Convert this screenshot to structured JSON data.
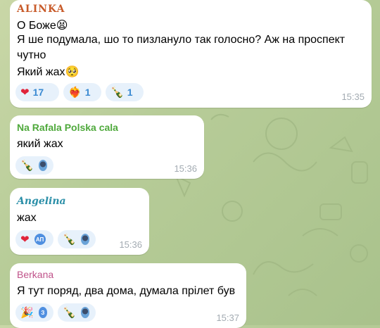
{
  "messages": [
    {
      "sender": "ALINKA",
      "sender_color": "#c85b2a",
      "lines": [
        "О Боже😫",
        "Я ше подумала, шо то пизлануло так голосно? Аж на проспект",
        "чутно",
        "Який жах🥺"
      ],
      "reactions": [
        {
          "emoji": "❤",
          "count": "17"
        },
        {
          "emoji": "❤‍🔥",
          "count": "1"
        },
        {
          "emoji": "🍾",
          "count": "1"
        }
      ],
      "time": "15:35"
    },
    {
      "sender": "Na Rafala Polska cala",
      "sender_color": "#4fa93c",
      "lines": [
        "який жах"
      ],
      "reactions": [
        {
          "emoji": "🍾"
        }
      ],
      "time": "15:36"
    },
    {
      "sender": "Angelina",
      "sender_color": "#2b8fa8",
      "lines": [
        "жах"
      ],
      "reactions": [
        {
          "emoji": "❤",
          "avatar_initials": "АП"
        },
        {
          "emoji": "🍾"
        }
      ],
      "time": "15:36"
    },
    {
      "sender": "Berkana",
      "sender_color": "#c0538a",
      "lines": [
        "Я тут поряд, два дома, думала прілет був"
      ],
      "reactions": [
        {
          "emoji": "🎉",
          "avatar_initials": "З"
        },
        {
          "emoji": "🍾"
        }
      ],
      "time": "15:37"
    }
  ]
}
